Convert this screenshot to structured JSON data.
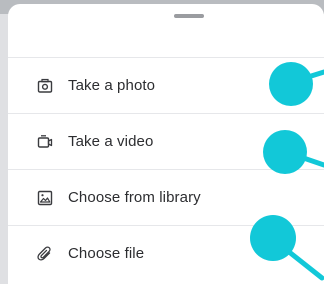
{
  "sheet": {
    "items": [
      {
        "label": "Take a photo",
        "icon": "camera-icon"
      },
      {
        "label": "Take a video",
        "icon": "video-camera-icon"
      },
      {
        "label": "Choose from library",
        "icon": "image-icon"
      },
      {
        "label": "Choose file",
        "icon": "paperclip-icon"
      }
    ]
  },
  "colors": {
    "annotation": "#12c8d8",
    "text": "#2c2d30",
    "icon": "#3a3b3f",
    "divider": "#e6e7ea"
  }
}
